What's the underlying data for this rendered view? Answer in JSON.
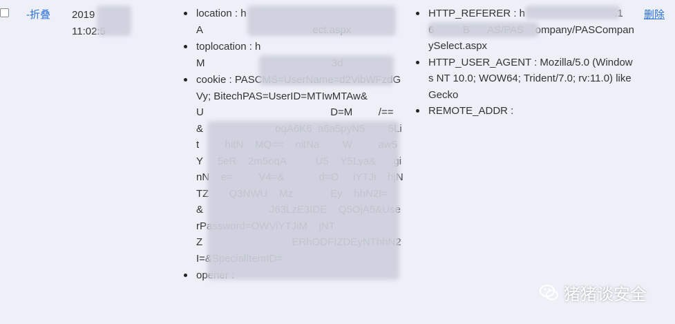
{
  "row": {
    "collapse_label": "-折叠",
    "date": "2019",
    "time": "11:02:5",
    "delete_label": "删除"
  },
  "request_fields": [
    "location : h                              A                                      ect.aspx",
    "toplocation : h                           M                                            3d",
    "cookie : PASCMS=UserName=d2VibWFzdGVy; BitechPAS=UserID=MTIwMTAw&U                                            D=M         /==&                         oqA6K6  a6a5pyN5        5Lit         hitN    MQ==    nitNa        W         aw5Y     5eR    2m5oqA          U5    Y5Lya&      ginN    e=         V4=&            d=O     iYTJi    hjNTZ       Q3NWU    Mz             Ey    hhN2I=&                       J63LzE3IDE    Q5OjA5&UserPassword=OWViYTJiM    jNTZ                               ERhODFIZDEyNThhN2I=&SpecialItemID=",
    "opener :"
  ],
  "header_fields": [
    "HTTP_REFERER : h                               .16          B      AS/PAS    ompany/PASCompanySelect.aspx",
    "HTTP_USER_AGENT : Mozilla/5.0 (Windows NT 10.0; WOW64; Trident/7.0; rv:11.0) like Gecko",
    "REMOTE_ADDR :"
  ],
  "watermark": {
    "text": "猪猪谈安全",
    "icon": "wechat-icon"
  },
  "colors": {
    "background": "#eef0f8",
    "link": "#2b6fd6"
  }
}
